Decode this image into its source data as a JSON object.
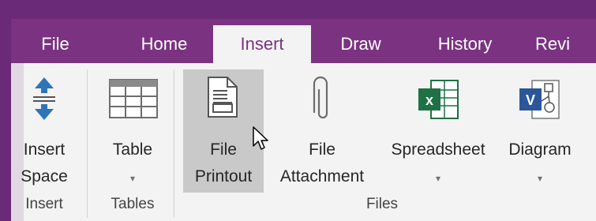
{
  "tabs": [
    {
      "label": "File",
      "active": false
    },
    {
      "label": "Home",
      "active": false
    },
    {
      "label": "Insert",
      "active": true
    },
    {
      "label": "Draw",
      "active": false
    },
    {
      "label": "History",
      "active": false
    },
    {
      "label": "Revi",
      "active": false
    }
  ],
  "ribbon": {
    "insert_space": {
      "line1": "Insert",
      "line2": "Space",
      "icon": "insert-space-icon"
    },
    "table": {
      "line1": "Table",
      "caret": "▾",
      "icon": "table-icon"
    },
    "file_printout": {
      "line1": "File",
      "line2": "Printout",
      "icon": "file-printout-icon"
    },
    "file_attachment": {
      "line1": "File",
      "line2": "Attachment",
      "icon": "paperclip-icon"
    },
    "spreadsheet": {
      "line1": "Spreadsheet",
      "caret": "▾",
      "icon": "excel-spreadsheet-icon"
    },
    "diagram": {
      "line1": "Diagram",
      "caret": "▾",
      "icon": "visio-diagram-icon"
    }
  },
  "groups": {
    "insert": "Insert",
    "tables": "Tables",
    "files": "Files"
  },
  "colors": {
    "accent": "#7b3381",
    "background_border": "#6b2a77",
    "ribbon_bg": "#f3f3f3",
    "hover": "#c9c9c9",
    "excel_green": "#1e7145",
    "visio_blue": "#2b579a"
  }
}
